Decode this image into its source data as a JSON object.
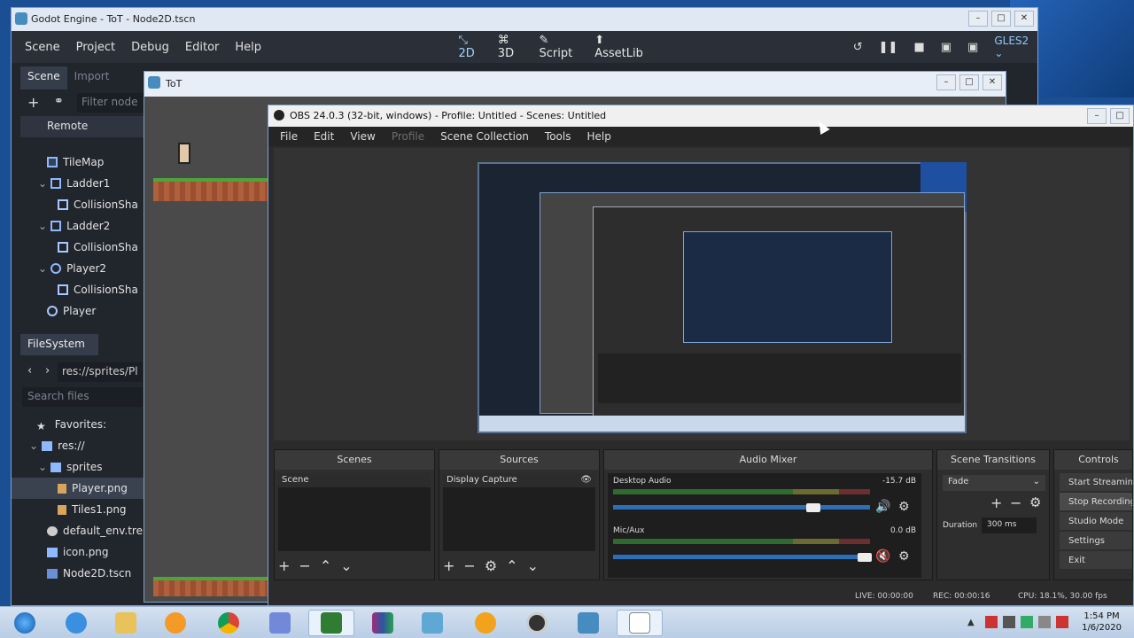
{
  "godot": {
    "title": "Godot Engine - ToT - Node2D.tscn",
    "menu": [
      "Scene",
      "Project",
      "Debug",
      "Editor",
      "Help"
    ],
    "modes": [
      {
        "label": "2D",
        "icon": "2d-icon"
      },
      {
        "label": "3D",
        "icon": "3d-icon"
      },
      {
        "label": "Script",
        "icon": "script-icon"
      },
      {
        "label": "AssetLib",
        "icon": "assetlib-icon"
      }
    ],
    "renderer": "GLES2",
    "dock_tabs": [
      "Scene",
      "Import"
    ],
    "filter_placeholder": "Filter node",
    "remote_label": "Remote",
    "tree": [
      {
        "label": "TileMap",
        "icon": "tilemap-icon"
      },
      {
        "label": "Ladder1",
        "icon": "area2d-icon"
      },
      {
        "label": "CollisionSha",
        "icon": "collision-shape-icon"
      },
      {
        "label": "Ladder2",
        "icon": "area2d-icon"
      },
      {
        "label": "CollisionSha",
        "icon": "collision-shape-icon"
      },
      {
        "label": "Player2",
        "icon": "kinematic-body-icon"
      },
      {
        "label": "CollisionSha",
        "icon": "collision-shape-icon"
      },
      {
        "label": "Player",
        "icon": "player-icon"
      }
    ],
    "filesystem_tab": "FileSystem",
    "path": "res://sprites/Pl",
    "search_placeholder": "Search files",
    "files": [
      {
        "label": "Favorites:",
        "type": "star"
      },
      {
        "label": "res://",
        "type": "folder"
      },
      {
        "label": "sprites",
        "type": "folder"
      },
      {
        "label": "Player.png",
        "type": "file"
      },
      {
        "label": "Tiles1.png",
        "type": "file"
      },
      {
        "label": "default_env.tre",
        "type": "file"
      },
      {
        "label": "icon.png",
        "type": "file"
      },
      {
        "label": "Node2D.tscn",
        "type": "file"
      }
    ]
  },
  "tot": {
    "title": "ToT"
  },
  "obs": {
    "title": "OBS 24.0.3 (32-bit, windows) - Profile: Untitled - Scenes: Untitled",
    "menu": [
      "File",
      "Edit",
      "View",
      "Profile",
      "Scene Collection",
      "Tools",
      "Help"
    ],
    "docks": {
      "scenes": {
        "title": "Scenes",
        "item": "Scene"
      },
      "sources": {
        "title": "Sources",
        "item": "Display Capture"
      },
      "mixer": {
        "title": "Audio Mixer",
        "channels": [
          {
            "name": "Desktop Audio",
            "db": "-15.7 dB",
            "level": 0.78,
            "muted": false
          },
          {
            "name": "Mic/Aux",
            "db": "0.0 dB",
            "level": 0.98,
            "muted": true
          }
        ]
      },
      "transitions": {
        "title": "Scene Transitions",
        "type": "Fade",
        "duration_label": "Duration",
        "duration": "300 ms"
      },
      "controls": {
        "title": "Controls",
        "buttons": [
          "Start Streaming",
          "Stop Recording",
          "Studio Mode",
          "Settings",
          "Exit"
        ]
      }
    },
    "status": {
      "live": "LIVE: 00:00:00",
      "rec": "REC: 00:00:16",
      "cpu": "CPU: 18.1%, 30.00 fps"
    }
  },
  "taskbar": {
    "apps": [
      "start",
      "ie",
      "explorer",
      "media-player",
      "chrome",
      "discord",
      "game",
      "winrar",
      "virtualbox",
      "headphones",
      "obs",
      "godot",
      "notepad"
    ],
    "time": "1:54 PM",
    "date": "1/6/2020"
  }
}
